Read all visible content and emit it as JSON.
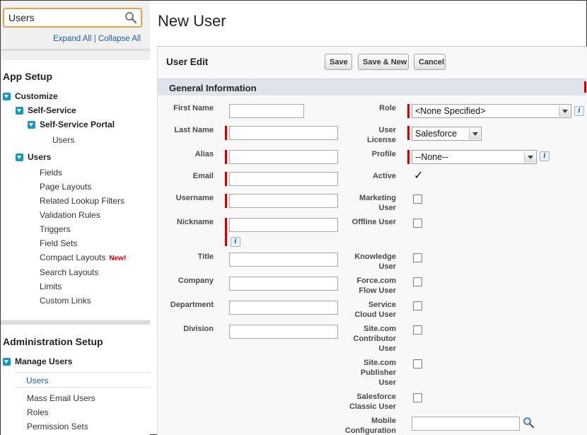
{
  "sidebar": {
    "search_value": "Users",
    "expand_all": "Expand All",
    "separator": "|",
    "collapse_all": "Collapse All",
    "app_setup": {
      "title": "App Setup",
      "customize": "Customize",
      "self_service": "Self-Service",
      "self_service_portal": "Self-Service Portal",
      "portal_users": "Users",
      "users_group": "Users",
      "links": [
        "Fields",
        "Page Layouts",
        "Related Lookup Filters",
        "Validation Rules",
        "Triggers",
        "Field Sets",
        "Compact Layouts",
        "Search Layouts",
        "Limits",
        "Custom Links"
      ],
      "new_badge": "New!"
    },
    "admin_setup": {
      "title": "Administration Setup",
      "manage_users": "Manage Users",
      "selected": "Users",
      "links": [
        "Mass Email Users",
        "Roles",
        "Permission Sets"
      ]
    }
  },
  "page": {
    "title": "New User",
    "panel_title": "User Edit",
    "buttons": {
      "save": "Save",
      "save_new": "Save & New",
      "cancel": "Cancel"
    },
    "section_title": "General Information",
    "left_fields": {
      "first_name": "First Name",
      "last_name": "Last Name",
      "alias": "Alias",
      "email": "Email",
      "username": "Username",
      "nickname": "Nickname",
      "title": "Title",
      "company": "Company",
      "department": "Department",
      "division": "Division"
    },
    "right_fields": {
      "role": "Role",
      "role_value": "<None Specified>",
      "user_license_1": "User",
      "user_license_2": "License",
      "user_license_value": "Salesforce",
      "profile": "Profile",
      "profile_value": "--None--",
      "active": "Active",
      "active_check": "✓",
      "marketing_1": "Marketing",
      "marketing_2": "User",
      "offline_user": "Offline User",
      "knowledge_1": "Knowledge",
      "knowledge_2": "User",
      "flow_1": "Force.com",
      "flow_2": "Flow User",
      "service_1": "Service",
      "service_2": "Cloud User",
      "sitecontrib_1": "Site.com",
      "sitecontrib_2": "Contributor",
      "sitecontrib_3": "User",
      "sitepub_1": "Site.com",
      "sitepub_2": "Publisher",
      "sitepub_3": "User",
      "classic_1": "Salesforce",
      "classic_2": "Classic User",
      "mobile_1": "Mobile",
      "mobile_2": "Configuration"
    },
    "info_glyph": "i"
  }
}
